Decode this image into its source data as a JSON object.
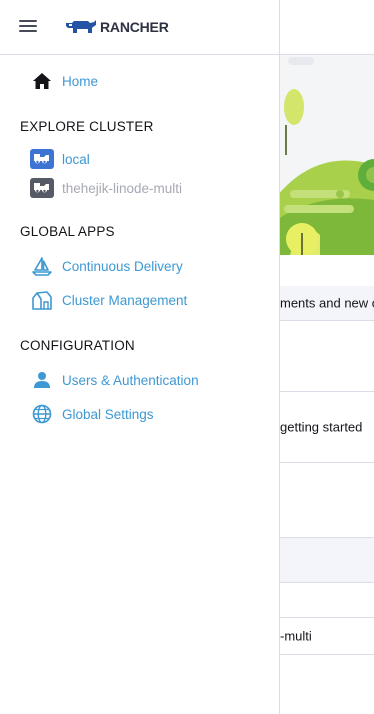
{
  "header": {
    "logo_text": "RANCHER"
  },
  "nav": {
    "home": {
      "label": "Home",
      "icon": "home-icon"
    },
    "sections": [
      {
        "title": "EXPLORE CLUSTER",
        "items": [
          {
            "label": "local",
            "icon": "cluster-icon",
            "state": "active"
          },
          {
            "label": "thehejik-linode-multi",
            "icon": "cluster-icon",
            "state": "inactive"
          }
        ]
      },
      {
        "title": "GLOBAL APPS",
        "items": [
          {
            "label": "Continuous Delivery",
            "icon": "sailboat-icon"
          },
          {
            "label": "Cluster Management",
            "icon": "barn-icon"
          }
        ]
      },
      {
        "title": "CONFIGURATION",
        "items": [
          {
            "label": "Users & Authentication",
            "icon": "user-icon"
          },
          {
            "label": "Global Settings",
            "icon": "globe-icon"
          }
        ]
      }
    ]
  },
  "background": {
    "row1_text": "ments and new c",
    "row2_text": "getting started",
    "row3_text": "-multi"
  },
  "colors": {
    "link": "#3d98d3",
    "muted": "#a7a9b5",
    "logo_blue": "#2453a6",
    "border": "#dcdee7"
  }
}
